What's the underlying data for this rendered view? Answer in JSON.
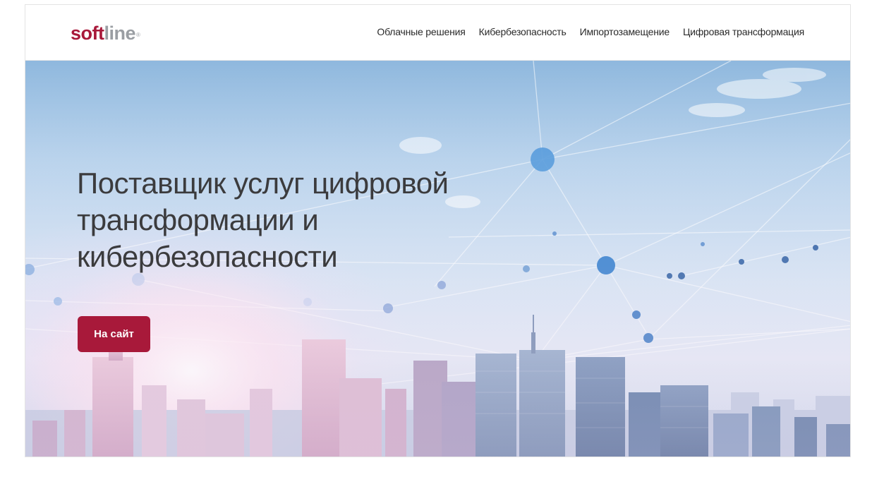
{
  "header": {
    "logo": {
      "part1": "soft",
      "part2": "line",
      "reg": "®"
    },
    "nav": [
      {
        "label": "Облачные решения"
      },
      {
        "label": "Кибербезопасность"
      },
      {
        "label": "Импортозамещение"
      },
      {
        "label": "Цифровая трансформация"
      }
    ]
  },
  "hero": {
    "title_lines": [
      "Поставщик услуг цифровой",
      "трансформации и",
      "кибербезопасности"
    ],
    "cta_label": "На сайт"
  },
  "colors": {
    "brand": "#a8193a",
    "logo_gray": "#9a9ea3",
    "text": "#3b3b3d"
  }
}
